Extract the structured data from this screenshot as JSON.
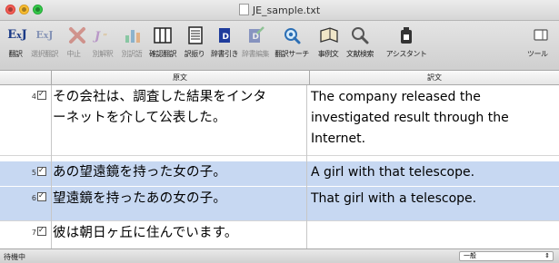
{
  "window": {
    "title": "JE_sample.txt"
  },
  "toolbar": {
    "items": [
      {
        "label": "翻訳",
        "icon": "ej-translate-icon",
        "enabled": true
      },
      {
        "label": "選択翻訳",
        "icon": "ej-selection-translate-icon",
        "enabled": false
      },
      {
        "label": "中止",
        "icon": "stop-x-icon",
        "enabled": false
      },
      {
        "label": "別解釈",
        "icon": "alternative-interpretation-icon",
        "enabled": false
      },
      {
        "label": "別訳語",
        "icon": "alternative-word-icon",
        "enabled": false
      },
      {
        "label": "確認翻訳",
        "icon": "confirm-translate-icon",
        "enabled": true
      },
      {
        "label": "訳振り",
        "icon": "interlinear-translation-icon",
        "enabled": true
      },
      {
        "label": "辞書引き",
        "icon": "dictionary-lookup-icon",
        "enabled": true
      },
      {
        "label": "辞書編集",
        "icon": "dictionary-edit-icon",
        "enabled": false
      },
      {
        "label": "翻訳サーチ",
        "icon": "translation-search-icon",
        "enabled": true
      },
      {
        "label": "事例文",
        "icon": "example-sentence-icon",
        "enabled": true
      },
      {
        "label": "文献検索",
        "icon": "literature-search-icon",
        "enabled": true
      },
      {
        "label": "アシスタント",
        "icon": "assistant-icon",
        "enabled": true
      },
      {
        "label": "ツール",
        "icon": "tool-icon",
        "enabled": true
      }
    ]
  },
  "columns": {
    "source": "原文",
    "target": "訳文"
  },
  "rows": [
    {
      "num": "4",
      "checked": true,
      "source": "その会社は、調査した結果をインターネットを介して公表した。",
      "source_lines": [
        "その会社は、調査した結果をインタ",
        "ーネットを介して公表した。"
      ],
      "target_lines": [
        "The company released the",
        "investigated result through the",
        "Internet."
      ],
      "selected": false
    },
    {
      "num": "5",
      "checked": true,
      "source_lines": [
        "あの望遠鏡を持った女の子。"
      ],
      "target_lines": [
        "A girl with that telescope."
      ],
      "selected": true
    },
    {
      "num": "6",
      "checked": true,
      "source_lines": [
        "望遠鏡を持ったあの女の子。"
      ],
      "target_lines": [
        "That girl with a telescope."
      ],
      "selected": true
    },
    {
      "num": "7",
      "checked": true,
      "source_lines": [
        "彼は朝日ヶ丘に住んでいます。"
      ],
      "target_lines": [
        ""
      ],
      "selected": false
    }
  ],
  "status": {
    "state": "待機中",
    "mode": "一般"
  },
  "colors": {
    "selection": "#c7d8f2",
    "brand_blue": "#1b3a86"
  }
}
